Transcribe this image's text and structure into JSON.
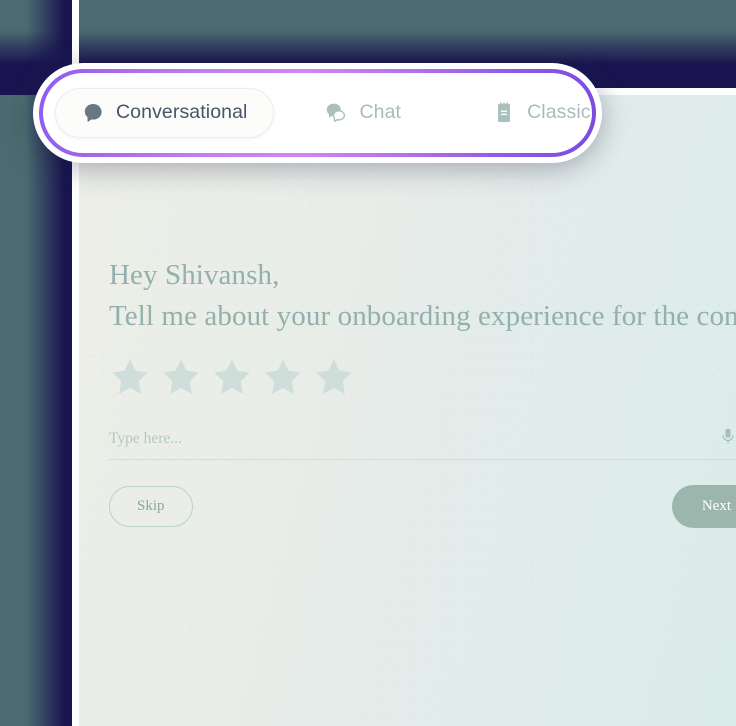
{
  "colors": {
    "background_teal": "#4b6b70",
    "background_navy": "#1a1550",
    "panel_gradient_start": "#eceee7",
    "panel_gradient_end": "#dceceb",
    "ring_gradient_left": "#8b5cf6",
    "ring_gradient_mid": "#cf86f2",
    "ring_gradient_right": "#7c4ae0",
    "heading_sage": "#93b0ae",
    "star_sage": "#cfdedb",
    "next_button_fill": "#9cb6ad",
    "active_tab_text": "#475569",
    "inactive_tab_text": "#a9bcba"
  },
  "mode_switcher": {
    "tabs": [
      {
        "id": "conversational",
        "label": "Conversational",
        "icon": "speech-bubble-icon",
        "active": true
      },
      {
        "id": "chat",
        "label": "Chat",
        "icon": "double-speech-bubble-icon",
        "active": false
      },
      {
        "id": "classic",
        "label": "Classic",
        "icon": "notepad-icon",
        "active": false
      }
    ]
  },
  "survey": {
    "heading": "Hey Shivansh,\nTell me about your onboarding experience for the company.",
    "rating": {
      "icon": "star-icon",
      "total": 5,
      "selected": 0
    },
    "answer": {
      "value": "",
      "placeholder": "Type here...",
      "mic_icon": "microphone-icon"
    },
    "actions": {
      "skip_label": "Skip",
      "next_label": "Next"
    }
  }
}
